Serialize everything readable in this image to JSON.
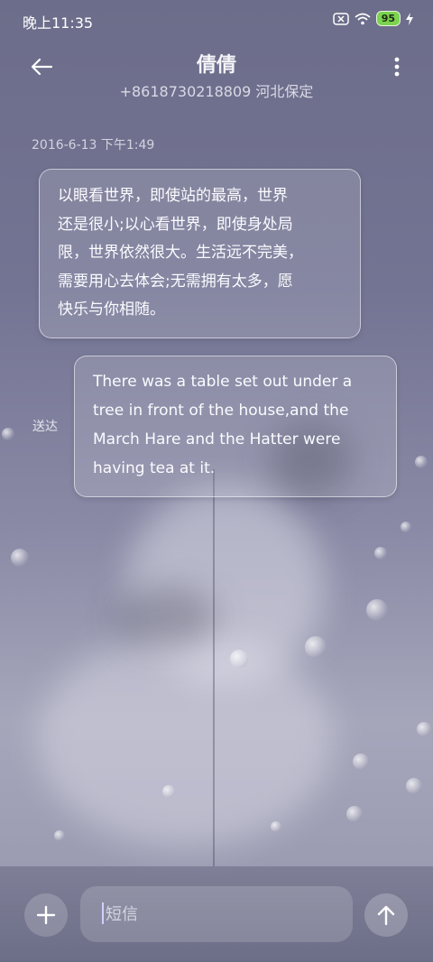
{
  "status_bar": {
    "time": "晚上11:35",
    "battery": "95",
    "icons": [
      "sim-off-icon",
      "wifi-icon",
      "battery-icon",
      "charging-icon"
    ]
  },
  "header": {
    "title": "倩倩",
    "subtitle": "+8618730218809 河北保定",
    "back_icon": "arrow-left-icon",
    "more_icon": "more-vertical-icon"
  },
  "conversation": {
    "timestamp": "2016-6-13 下午1:49",
    "messages": [
      {
        "direction": "incoming",
        "lines": [
          "以眼看世界，即使站的最高，世界",
          "还是很小;以心看世界，即使身处局",
          "限，世界依然很大。生活远不完美，",
          "需要用心去体会;无需拥有太多，愿",
          "快乐与你相随。"
        ]
      },
      {
        "direction": "outgoing",
        "lines": [
          "There was a table set out under a",
          "tree in front of the house,and the",
          "March Hare and the Hatter were",
          "having tea at it."
        ],
        "status": "送达"
      }
    ]
  },
  "composer": {
    "placeholder": "短信",
    "add_icon": "plus-icon",
    "send_icon": "arrow-up-icon"
  },
  "colors": {
    "background": "#737493",
    "battery": "#7bd34f",
    "cursor": "#cfd0ff"
  }
}
